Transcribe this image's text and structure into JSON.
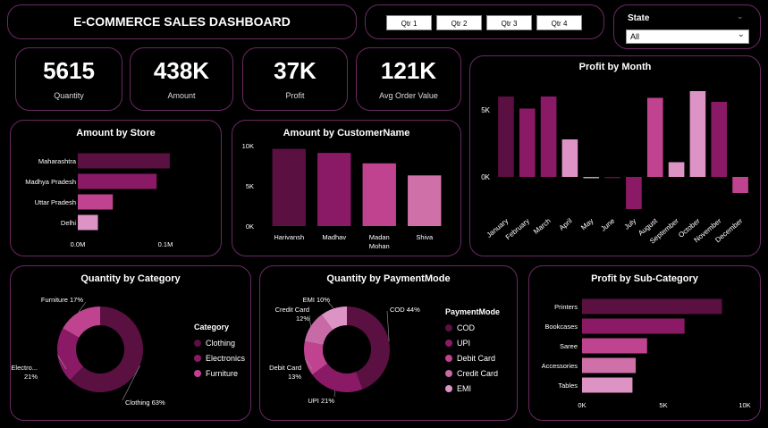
{
  "header": {
    "title": "E-COMMERCE SALES DASHBOARD"
  },
  "quarters": [
    "Qtr 1",
    "Qtr 2",
    "Qtr 3",
    "Qtr 4"
  ],
  "state_filter": {
    "label": "State",
    "value": "All"
  },
  "kpis": [
    {
      "value": "5615",
      "label": "Quantity"
    },
    {
      "value": "438K",
      "label": "Amount"
    },
    {
      "value": "37K",
      "label": "Profit"
    },
    {
      "value": "121K",
      "label": "Avg Order Value"
    }
  ],
  "colors": {
    "c1": "#5a1040",
    "c2": "#8b1a66",
    "c3": "#c0438f",
    "c4": "#dd94c4",
    "border": "#6b2a63"
  },
  "chart_data": [
    {
      "id": "profit_by_month",
      "type": "bar",
      "title": "Profit by Month",
      "categories": [
        "January",
        "February",
        "March",
        "April",
        "May",
        "June",
        "July",
        "August",
        "September",
        "October",
        "November",
        "December"
      ],
      "values": [
        6000,
        5100,
        6000,
        2800,
        -100,
        -100,
        -2400,
        5900,
        1100,
        6400,
        5600,
        -1200
      ],
      "ytick_labels": [
        "5K",
        "0K"
      ],
      "yticks": [
        5000,
        0
      ],
      "ylim": [
        -2800,
        7000
      ],
      "colors": [
        "#5a1040",
        "#8b1a66",
        "#8b1a66",
        "#dd94c4",
        "#aaaaaa",
        "#5a1040",
        "#8b1a66",
        "#c0438f",
        "#dd94c4",
        "#dd94c4",
        "#8b1a66",
        "#c0438f"
      ]
    },
    {
      "id": "amount_by_store",
      "type": "bar",
      "orientation": "horizontal",
      "title": "Amount by Store",
      "categories": [
        "Maharashtra",
        "Madhya Pradesh",
        "Uttar Pradesh",
        "Delhi"
      ],
      "values": [
        105000,
        90000,
        40000,
        23000
      ],
      "xtick_labels": [
        "0.0M",
        "0.1M"
      ],
      "xticks": [
        0,
        100000
      ],
      "xlim": [
        0,
        100000
      ],
      "colors": [
        "#5a1040",
        "#8b1a66",
        "#c0438f",
        "#dd94c4"
      ]
    },
    {
      "id": "amount_by_customer",
      "type": "bar",
      "title": "Amount by CustomerName",
      "categories": [
        "Harivansh",
        "Madhav",
        "Madan Mohan",
        "Shiva"
      ],
      "category_lines": [
        [
          "Harivansh"
        ],
        [
          "Madhav"
        ],
        [
          "Madan",
          "Mohan"
        ],
        [
          "Shiva"
        ]
      ],
      "values": [
        9600,
        9100,
        7800,
        6300
      ],
      "ytick_labels": [
        "10K",
        "5K",
        "0K"
      ],
      "yticks": [
        10000,
        5000,
        0
      ],
      "ylim": [
        0,
        10000
      ],
      "colors": [
        "#5a1040",
        "#8b1a66",
        "#c0438f",
        "#d070a8"
      ]
    },
    {
      "id": "quantity_by_category",
      "type": "pie",
      "donut": true,
      "title": "Quantity by Category",
      "legend_title": "Category",
      "labels": [
        "Clothing",
        "Electronics",
        "Furniture"
      ],
      "values": [
        63,
        21,
        17
      ],
      "slice_labels": [
        [
          "Clothing 63%"
        ],
        [
          "Electro...",
          "21%"
        ],
        [
          "Furniture 17%"
        ]
      ],
      "colors": [
        "#5a1040",
        "#8b1a66",
        "#c0438f"
      ]
    },
    {
      "id": "quantity_by_paymentmode",
      "type": "pie",
      "donut": true,
      "title": "Quantity by PaymentMode",
      "legend_title": "PaymentMode",
      "labels": [
        "COD",
        "UPI",
        "Debit Card",
        "Credit Card",
        "EMI"
      ],
      "values": [
        44,
        21,
        13,
        12,
        10
      ],
      "slice_labels": [
        [
          "COD 44%"
        ],
        [
          "UPI 21%"
        ],
        [
          "Debit Card",
          "13%"
        ],
        [
          "Credit Card",
          "12%"
        ],
        [
          "EMI 10%"
        ]
      ],
      "colors": [
        "#5a1040",
        "#8b1a66",
        "#c0438f",
        "#c86aa6",
        "#dd94c4"
      ]
    },
    {
      "id": "profit_by_subcategory",
      "type": "bar",
      "orientation": "horizontal",
      "title": "Profit by Sub-Category",
      "categories": [
        "Printers",
        "Bookcases",
        "Saree",
        "Accessories",
        "Tables"
      ],
      "values": [
        8600,
        6300,
        4000,
        3300,
        3100
      ],
      "xtick_labels": [
        "0K",
        "5K",
        "10K"
      ],
      "xticks": [
        0,
        5000,
        10000
      ],
      "xlim": [
        0,
        10000
      ],
      "colors": [
        "#5a1040",
        "#8b1a66",
        "#c0438f",
        "#d070a8",
        "#dd94c4"
      ]
    }
  ]
}
